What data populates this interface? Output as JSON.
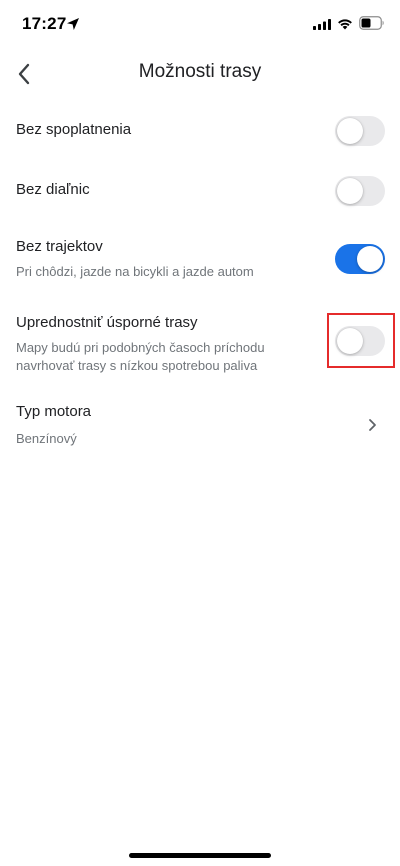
{
  "status_bar": {
    "time": "17:27"
  },
  "header": {
    "title": "Možnosti trasy"
  },
  "options": [
    {
      "title": "Bez spoplatnenia",
      "enabled": false
    },
    {
      "title": "Bez diaľnic",
      "enabled": false
    },
    {
      "title": "Bez trajektov",
      "subtitle": "Pri chôdzi, jazde na bicykli a jazde autom",
      "enabled": true
    },
    {
      "title": "Uprednostniť úsporné trasy",
      "subtitle": "Mapy budú pri podobných časoch príchodu navrhovať trasy s nízkou spotrebou paliva",
      "enabled": false
    }
  ],
  "engine": {
    "title": "Typ motora",
    "value": "Benzínový"
  },
  "colors": {
    "toggle_on": "#1a73e8",
    "toggle_off": "#e9e9eb",
    "highlight": "#e52b2b"
  }
}
